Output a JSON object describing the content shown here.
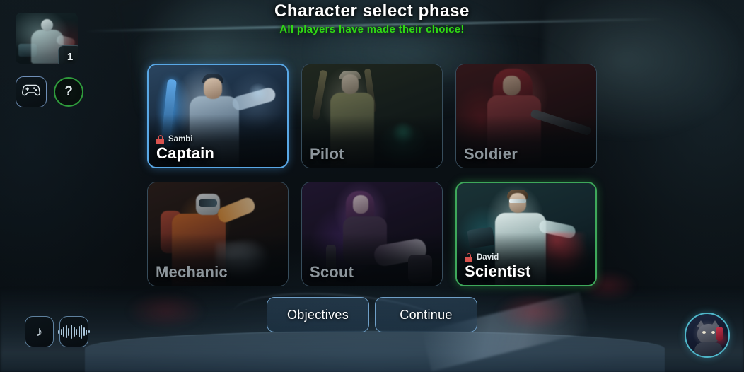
{
  "header": {
    "title": "Character select phase",
    "subtitle": "All players have made their choice!",
    "subtitle_color": "#2fd914"
  },
  "player_panel": {
    "avatar_name": "player-avatar",
    "level_badge": "1",
    "gamepad_icon": "gamepad-icon",
    "help_icon": "?",
    "gamepad_border_color": "#6f8fb8",
    "help_border_color": "#2f9b3c"
  },
  "characters": [
    {
      "name": "Captain",
      "owner": "Sambi",
      "locked": true,
      "selected": true,
      "selection_color": "#59a8e6",
      "art": "art-captain"
    },
    {
      "name": "Pilot",
      "owner": "",
      "locked": false,
      "selected": false,
      "selection_color": "",
      "art": "art-pilot"
    },
    {
      "name": "Soldier",
      "owner": "",
      "locked": false,
      "selected": false,
      "selection_color": "",
      "art": "art-soldier"
    },
    {
      "name": "Mechanic",
      "owner": "",
      "locked": false,
      "selected": false,
      "selection_color": "",
      "art": "art-mechanic"
    },
    {
      "name": "Scout",
      "owner": "",
      "locked": false,
      "selected": false,
      "selection_color": "",
      "art": "art-scout"
    },
    {
      "name": "Scientist",
      "owner": "David",
      "locked": true,
      "selected": true,
      "selection_color": "#3ea85a",
      "art": "art-scientist"
    }
  ],
  "actions": {
    "objectives_label": "Objectives",
    "continue_label": "Continue",
    "border_color": "#6f9fc7"
  },
  "audio": {
    "music_icon": "music-note-icon",
    "music_glyph": "♪",
    "sfx_icon": "audio-waveform-icon",
    "waveform_bars": [
      5,
      9,
      14,
      18,
      11,
      20,
      14,
      9,
      16,
      20,
      12,
      7,
      4
    ]
  },
  "user_avatar": {
    "name": "cat-headphones-avatar",
    "ring_color": "#4fb6c9"
  }
}
